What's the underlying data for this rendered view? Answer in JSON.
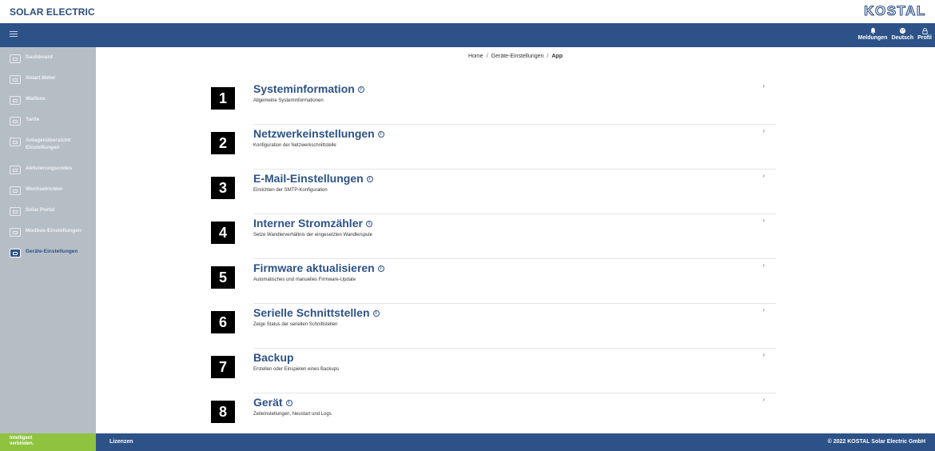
{
  "header": {
    "brand": "SOLAR ELECTRIC",
    "logo_text": "KOSTAL"
  },
  "navbar": {
    "notifications_label": "Meldungen",
    "language_label": "Deutsch",
    "profile_label": "Profil"
  },
  "sidebar": {
    "items": [
      {
        "label": "Dashboard",
        "icon": "dashboard-icon"
      },
      {
        "label": "Smart Meter",
        "icon": "smart-meter-icon"
      },
      {
        "label": "Wallbox",
        "icon": "wallbox-icon"
      },
      {
        "label": "Tarife",
        "icon": "tariff-icon"
      },
      {
        "label": "Anlagenübersicht/ Einstellungen",
        "icon": "plant-overview-icon"
      },
      {
        "label": "Aktivierungscodes",
        "icon": "activation-code-icon"
      },
      {
        "label": "Wechselrichter",
        "icon": "inverter-icon"
      },
      {
        "label": "Solar Portal",
        "icon": "solar-portal-icon"
      },
      {
        "label": "Modbus-Einstellungen",
        "icon": "modbus-icon"
      },
      {
        "label": "Geräte-Einstellungen",
        "icon": "device-settings-icon",
        "active": true
      }
    ]
  },
  "breadcrumb": {
    "home": "Home",
    "section": "Geräte-Einstellungen",
    "current": "App",
    "separator": "/"
  },
  "settings": [
    {
      "number": "1",
      "title": "Systeminformation",
      "subtitle": "Allgemeine Systeminformationen",
      "info": true
    },
    {
      "number": "2",
      "title": "Netzwerkeinstellungen",
      "subtitle": "Konfiguration der Netzwerkschnittstelle",
      "info": true
    },
    {
      "number": "3",
      "title": "E-Mail-Einstellungen",
      "subtitle": "Einrichten der SMTP-Konfiguration",
      "info": true
    },
    {
      "number": "4",
      "title": "Interner Stromzähler",
      "subtitle": "Setze Wandlerverhältnis der eingesetzten Wandlerspule",
      "info": true
    },
    {
      "number": "5",
      "title": "Firmware aktualisieren",
      "subtitle": "Automatisches und manuelles Firmware-Update",
      "info": true
    },
    {
      "number": "6",
      "title": "Serielle Schnittstellen",
      "subtitle": "Zeige Status der seriellen Schnittstellen",
      "info": true
    },
    {
      "number": "7",
      "title": "Backup",
      "subtitle": "Erstellen oder Einspielen eines Backups",
      "info": false
    },
    {
      "number": "8",
      "title": "Gerät",
      "subtitle": "Zeiteinstellungen, Neustart und Logs",
      "info": true
    }
  ],
  "chevron": "›",
  "info_glyph": "i",
  "footer": {
    "slogan_line1": "Intelligent",
    "slogan_line2": "verbinden.",
    "licenses": "Lizenzen",
    "copyright": "© 2022 KOSTAL Solar Electric GmbH"
  },
  "colors": {
    "primary": "#2d5288",
    "sidebar": "#b6bec5",
    "accent_green": "#8fc33f"
  }
}
